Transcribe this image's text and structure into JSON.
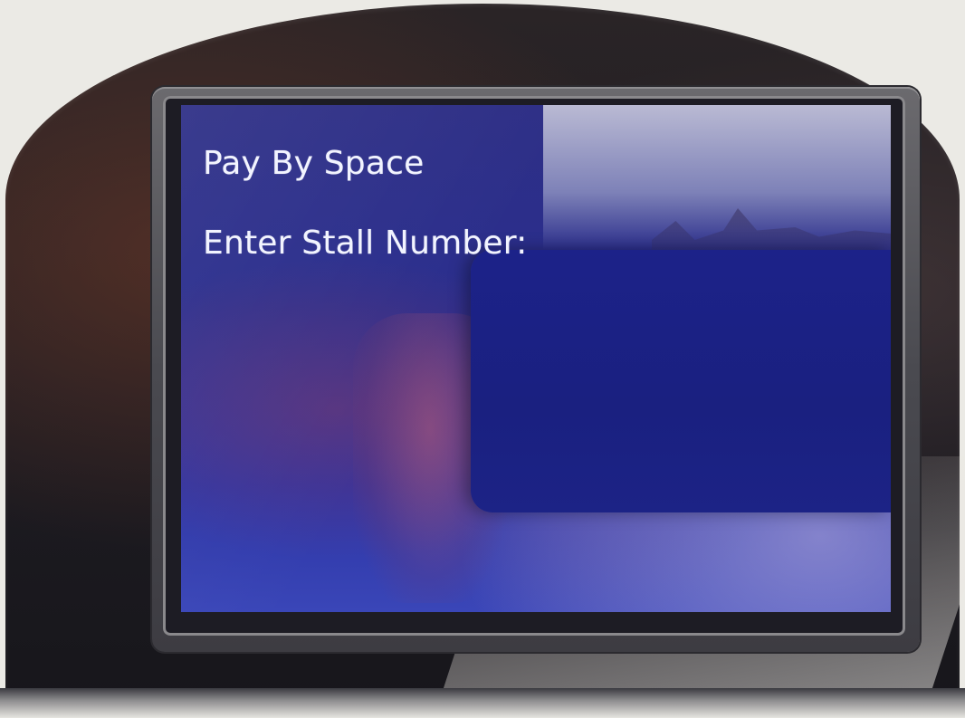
{
  "screen": {
    "title": "Pay By Space",
    "prompt": "Enter Stall Number:",
    "stall_number_value": ""
  },
  "colors": {
    "lcd_background": "#2b33a3",
    "lcd_text": "#f2f4ff",
    "bezel": "#4a4a50",
    "fascia": "#1e1c22",
    "housing": "#ebeae5"
  }
}
